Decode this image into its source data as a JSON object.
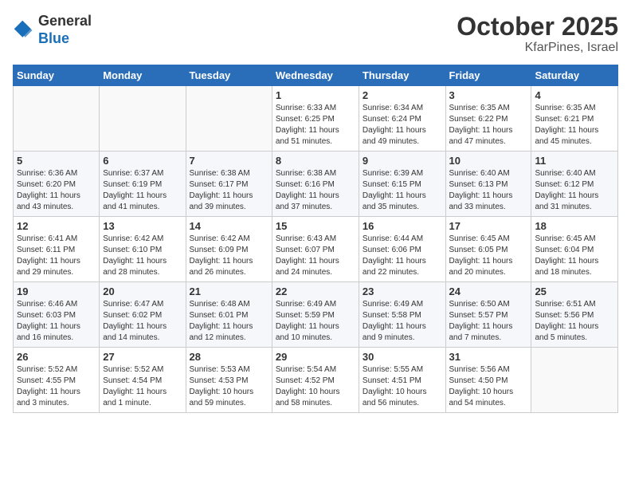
{
  "header": {
    "logo_line1": "General",
    "logo_line2": "Blue",
    "month": "October 2025",
    "location": "KfarPines, Israel"
  },
  "weekdays": [
    "Sunday",
    "Monday",
    "Tuesday",
    "Wednesday",
    "Thursday",
    "Friday",
    "Saturday"
  ],
  "weeks": [
    [
      {
        "day": "",
        "info": ""
      },
      {
        "day": "",
        "info": ""
      },
      {
        "day": "",
        "info": ""
      },
      {
        "day": "1",
        "info": "Sunrise: 6:33 AM\nSunset: 6:25 PM\nDaylight: 11 hours\nand 51 minutes."
      },
      {
        "day": "2",
        "info": "Sunrise: 6:34 AM\nSunset: 6:24 PM\nDaylight: 11 hours\nand 49 minutes."
      },
      {
        "day": "3",
        "info": "Sunrise: 6:35 AM\nSunset: 6:22 PM\nDaylight: 11 hours\nand 47 minutes."
      },
      {
        "day": "4",
        "info": "Sunrise: 6:35 AM\nSunset: 6:21 PM\nDaylight: 11 hours\nand 45 minutes."
      }
    ],
    [
      {
        "day": "5",
        "info": "Sunrise: 6:36 AM\nSunset: 6:20 PM\nDaylight: 11 hours\nand 43 minutes."
      },
      {
        "day": "6",
        "info": "Sunrise: 6:37 AM\nSunset: 6:19 PM\nDaylight: 11 hours\nand 41 minutes."
      },
      {
        "day": "7",
        "info": "Sunrise: 6:38 AM\nSunset: 6:17 PM\nDaylight: 11 hours\nand 39 minutes."
      },
      {
        "day": "8",
        "info": "Sunrise: 6:38 AM\nSunset: 6:16 PM\nDaylight: 11 hours\nand 37 minutes."
      },
      {
        "day": "9",
        "info": "Sunrise: 6:39 AM\nSunset: 6:15 PM\nDaylight: 11 hours\nand 35 minutes."
      },
      {
        "day": "10",
        "info": "Sunrise: 6:40 AM\nSunset: 6:13 PM\nDaylight: 11 hours\nand 33 minutes."
      },
      {
        "day": "11",
        "info": "Sunrise: 6:40 AM\nSunset: 6:12 PM\nDaylight: 11 hours\nand 31 minutes."
      }
    ],
    [
      {
        "day": "12",
        "info": "Sunrise: 6:41 AM\nSunset: 6:11 PM\nDaylight: 11 hours\nand 29 minutes."
      },
      {
        "day": "13",
        "info": "Sunrise: 6:42 AM\nSunset: 6:10 PM\nDaylight: 11 hours\nand 28 minutes."
      },
      {
        "day": "14",
        "info": "Sunrise: 6:42 AM\nSunset: 6:09 PM\nDaylight: 11 hours\nand 26 minutes."
      },
      {
        "day": "15",
        "info": "Sunrise: 6:43 AM\nSunset: 6:07 PM\nDaylight: 11 hours\nand 24 minutes."
      },
      {
        "day": "16",
        "info": "Sunrise: 6:44 AM\nSunset: 6:06 PM\nDaylight: 11 hours\nand 22 minutes."
      },
      {
        "day": "17",
        "info": "Sunrise: 6:45 AM\nSunset: 6:05 PM\nDaylight: 11 hours\nand 20 minutes."
      },
      {
        "day": "18",
        "info": "Sunrise: 6:45 AM\nSunset: 6:04 PM\nDaylight: 11 hours\nand 18 minutes."
      }
    ],
    [
      {
        "day": "19",
        "info": "Sunrise: 6:46 AM\nSunset: 6:03 PM\nDaylight: 11 hours\nand 16 minutes."
      },
      {
        "day": "20",
        "info": "Sunrise: 6:47 AM\nSunset: 6:02 PM\nDaylight: 11 hours\nand 14 minutes."
      },
      {
        "day": "21",
        "info": "Sunrise: 6:48 AM\nSunset: 6:01 PM\nDaylight: 11 hours\nand 12 minutes."
      },
      {
        "day": "22",
        "info": "Sunrise: 6:49 AM\nSunset: 5:59 PM\nDaylight: 11 hours\nand 10 minutes."
      },
      {
        "day": "23",
        "info": "Sunrise: 6:49 AM\nSunset: 5:58 PM\nDaylight: 11 hours\nand 9 minutes."
      },
      {
        "day": "24",
        "info": "Sunrise: 6:50 AM\nSunset: 5:57 PM\nDaylight: 11 hours\nand 7 minutes."
      },
      {
        "day": "25",
        "info": "Sunrise: 6:51 AM\nSunset: 5:56 PM\nDaylight: 11 hours\nand 5 minutes."
      }
    ],
    [
      {
        "day": "26",
        "info": "Sunrise: 5:52 AM\nSunset: 4:55 PM\nDaylight: 11 hours\nand 3 minutes."
      },
      {
        "day": "27",
        "info": "Sunrise: 5:52 AM\nSunset: 4:54 PM\nDaylight: 11 hours\nand 1 minute."
      },
      {
        "day": "28",
        "info": "Sunrise: 5:53 AM\nSunset: 4:53 PM\nDaylight: 10 hours\nand 59 minutes."
      },
      {
        "day": "29",
        "info": "Sunrise: 5:54 AM\nSunset: 4:52 PM\nDaylight: 10 hours\nand 58 minutes."
      },
      {
        "day": "30",
        "info": "Sunrise: 5:55 AM\nSunset: 4:51 PM\nDaylight: 10 hours\nand 56 minutes."
      },
      {
        "day": "31",
        "info": "Sunrise: 5:56 AM\nSunset: 4:50 PM\nDaylight: 10 hours\nand 54 minutes."
      },
      {
        "day": "",
        "info": ""
      }
    ]
  ]
}
